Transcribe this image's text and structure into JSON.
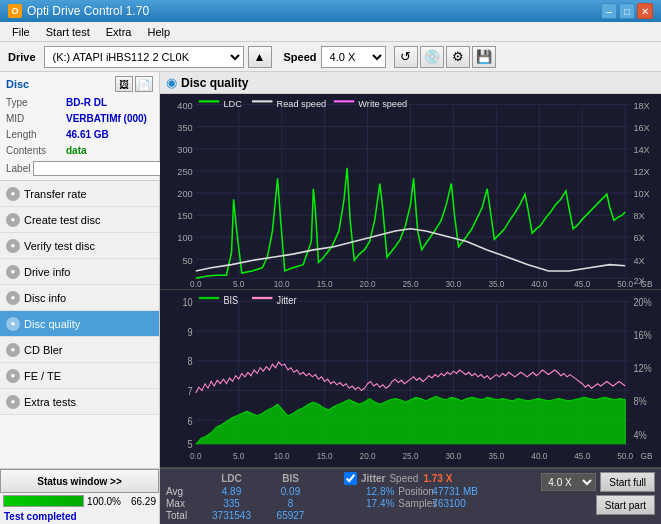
{
  "titleBar": {
    "icon": "O",
    "title": "Opti Drive Control 1.70",
    "minimize": "–",
    "maximize": "□",
    "close": "✕"
  },
  "menuBar": {
    "items": [
      "File",
      "Start test",
      "Extra",
      "Help"
    ]
  },
  "toolbar": {
    "driveLabel": "Drive",
    "driveValue": "(K:)  ATAPI iHBS112  2 CL0K",
    "speedLabel": "Speed",
    "speedValue": "4.0 X"
  },
  "disc": {
    "title": "Disc",
    "type_key": "Type",
    "type_val": "BD-R DL",
    "mid_key": "MID",
    "mid_val": "VERBATIMf (000)",
    "length_key": "Length",
    "length_val": "46.61 GB",
    "contents_key": "Contents",
    "contents_val": "data",
    "label_key": "Label",
    "label_val": ""
  },
  "navItems": [
    {
      "id": "transfer-rate",
      "label": "Transfer rate",
      "active": false
    },
    {
      "id": "create-test-disc",
      "label": "Create test disc",
      "active": false
    },
    {
      "id": "verify-test-disc",
      "label": "Verify test disc",
      "active": false
    },
    {
      "id": "drive-info",
      "label": "Drive info",
      "active": false
    },
    {
      "id": "disc-info",
      "label": "Disc info",
      "active": false
    },
    {
      "id": "disc-quality",
      "label": "Disc quality",
      "active": true
    },
    {
      "id": "cd-bler",
      "label": "CD Bler",
      "active": false
    },
    {
      "id": "fe-te",
      "label": "FE / TE",
      "active": false
    },
    {
      "id": "extra-tests",
      "label": "Extra tests",
      "active": false
    }
  ],
  "statusWindow": {
    "label": "Status window >>",
    "progress": 100.0,
    "progressText": "100.0%",
    "extraVal": "66.29"
  },
  "chartTitle": "Disc quality",
  "chart1": {
    "title": "Upper chart: LDC / Read speed / Write speed",
    "yMax": 400,
    "yAxisRight": [
      "18X",
      "16X",
      "14X",
      "12X",
      "10X",
      "8X",
      "6X",
      "4X",
      "2X"
    ],
    "legendLDC": "LDC",
    "legendRead": "Read speed",
    "legendWrite": "Write speed",
    "xMax": 50,
    "xLabels": [
      "0.0",
      "5.0",
      "10.0",
      "15.0",
      "20.0",
      "25.0",
      "30.0",
      "35.0",
      "40.0",
      "45.0",
      "50.0"
    ]
  },
  "chart2": {
    "title": "Lower chart: BIS / Jitter",
    "yMax": 10,
    "yAxisRight": [
      "20%",
      "16%",
      "12%",
      "8%",
      "4%"
    ],
    "legendBIS": "BIS",
    "legendJitter": "Jitter",
    "xMax": 50,
    "xLabels": [
      "0.0",
      "5.0",
      "10.0",
      "15.0",
      "20.0",
      "25.0",
      "30.0",
      "35.0",
      "40.0",
      "45.0",
      "50.0"
    ]
  },
  "stats": {
    "columns": [
      "LDC",
      "BIS",
      "",
      "Jitter"
    ],
    "avg_ldc": "4.89",
    "avg_bis": "0.09",
    "avg_jitter": "12.8%",
    "max_ldc": "335",
    "max_bis": "8",
    "max_jitter": "17.4%",
    "total_ldc": "3731543",
    "total_bis": "65927",
    "jitter_checked": true,
    "speed_label": "Speed",
    "speed_val": "1.73 X",
    "position_label": "Position",
    "position_val": "47731 MB",
    "samples_label": "Samples",
    "samples_val": "763100",
    "speed_select": "4.0 X",
    "startFull": "Start full",
    "startPart": "Start part",
    "rows": [
      "Avg",
      "Max",
      "Total"
    ]
  },
  "statusText": "Test completed"
}
